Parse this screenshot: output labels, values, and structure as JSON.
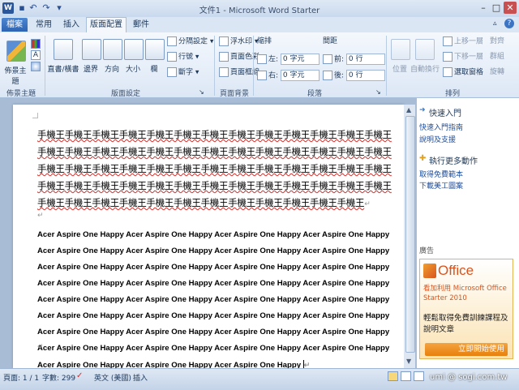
{
  "window": {
    "title": "文件1 - Microsoft Word Starter",
    "app_icon": "word-app-icon"
  },
  "quick_access": [
    "save-icon",
    "undo-icon",
    "redo-icon",
    "customize-icon"
  ],
  "tabs": [
    {
      "label": "檔案",
      "type": "file"
    },
    {
      "label": "常用"
    },
    {
      "label": "插入"
    },
    {
      "label": "版面配置",
      "active": true
    },
    {
      "label": "郵件"
    }
  ],
  "ribbon": {
    "theme_group": {
      "label": "佈景主題",
      "buttons": [
        {
          "label": "佈景主題"
        }
      ],
      "small_icons": [
        "colors-icon",
        "fonts-icon",
        "effects-icon"
      ]
    },
    "page_setup": {
      "label": "版面設定",
      "buttons": [
        {
          "label": "直書/橫書"
        },
        {
          "label": "邊界"
        },
        {
          "label": "方向"
        },
        {
          "label": "大小"
        },
        {
          "label": "欄"
        }
      ],
      "small_items": [
        "分隔設定",
        "行號",
        "斷字"
      ]
    },
    "background": {
      "label": "頁面背景",
      "small_items": [
        "浮水印",
        "頁面色彩",
        "頁面框線"
      ]
    },
    "paragraph": {
      "label": "段落",
      "indent_title": "縮排",
      "spacing_title": "間距",
      "left_label": "左:",
      "right_label": "右:",
      "before_label": "前:",
      "after_label": "後:",
      "left_value": "0 字元",
      "right_value": "0 字元",
      "before_value": "0 行",
      "after_value": "0 行"
    },
    "arrange": {
      "label": "排列",
      "buttons": [
        {
          "label": "位置"
        },
        {
          "label": "自動換行"
        }
      ],
      "small_items": [
        "上移一層",
        "下移一層",
        "選取窗格"
      ],
      "small_items2": [
        "對齊",
        "群組",
        "旋轉"
      ]
    }
  },
  "document": {
    "chinese_text": "手機王手機王手機王手機王手機王手機王手機王手機王手機王手機王手機王手機王手機王手機王手機王手機王手機王手機王手機王手機王手機王手機王手機王手機王手機王手機王手機王手機王手機王手機王手機王手機王手機王手機王手機王手機王手機王手機王手機王手機王手機王手機王手機王手機王手機王手機王手機王手機王手機王手機王手機王手機王手機王手機王手機王手機王手機王手機王手機王手機王手機王手機王手機王手機王",
    "english_text": "Acer Aspire One Happy Acer Aspire One Happy Acer Aspire One Happy Acer Aspire One Happy Acer Aspire One Happy Acer Aspire One Happy Acer Aspire One Happy Acer Aspire One Happy Acer Aspire One Happy Acer Aspire One Happy Acer Aspire One Happy Acer Aspire One Happy Acer Aspire One Happy Acer Aspire One Happy Acer Aspire One Happy Acer Aspire One Happy Acer Aspire One Happy Acer Aspire One Happy Acer Aspire One Happy Acer Aspire One Happy Acer Aspire One Happy Acer Aspire One Happy Acer Aspire One Happy Acer Aspire One Happy Acer Aspire One Happy Acer Aspire One Happy Acer Aspire One Happy Acer Aspire One Happy Acer Aspire One Happy Acer Aspire One Happy Acer Aspire One Happy Acer Aspire One Happy Acer Aspire One Happy Acer Aspire One Happy Acer Aspire One Happy",
    "para_mark": "↵"
  },
  "task_pane": {
    "section1_title": "快速入門",
    "section1_links": [
      "快速入門指南",
      "說明及支援"
    ],
    "section2_title": "執行更多動作",
    "section2_links": [
      "取得免費範本",
      "下載美工圖案"
    ],
    "ad_label": "廣告",
    "ad": {
      "brand": "Office",
      "headline": "看加利用 Microsoft Office Starter 2010",
      "body": "輕鬆取得免費訓練課程及說明文章",
      "cta": "立即開始使用"
    }
  },
  "status_bar": {
    "page": "頁面: 1 / 1",
    "words": "字數: 299",
    "language": "英文 (美國)",
    "mode": "插入",
    "watermark": "umi @ sogi.com.tw"
  },
  "colors": {
    "file_tab": "#2d64b3",
    "ribbon_bg": "#dce7f5",
    "spell_underline": "#d0312d",
    "ad_orange": "#e8800c"
  }
}
